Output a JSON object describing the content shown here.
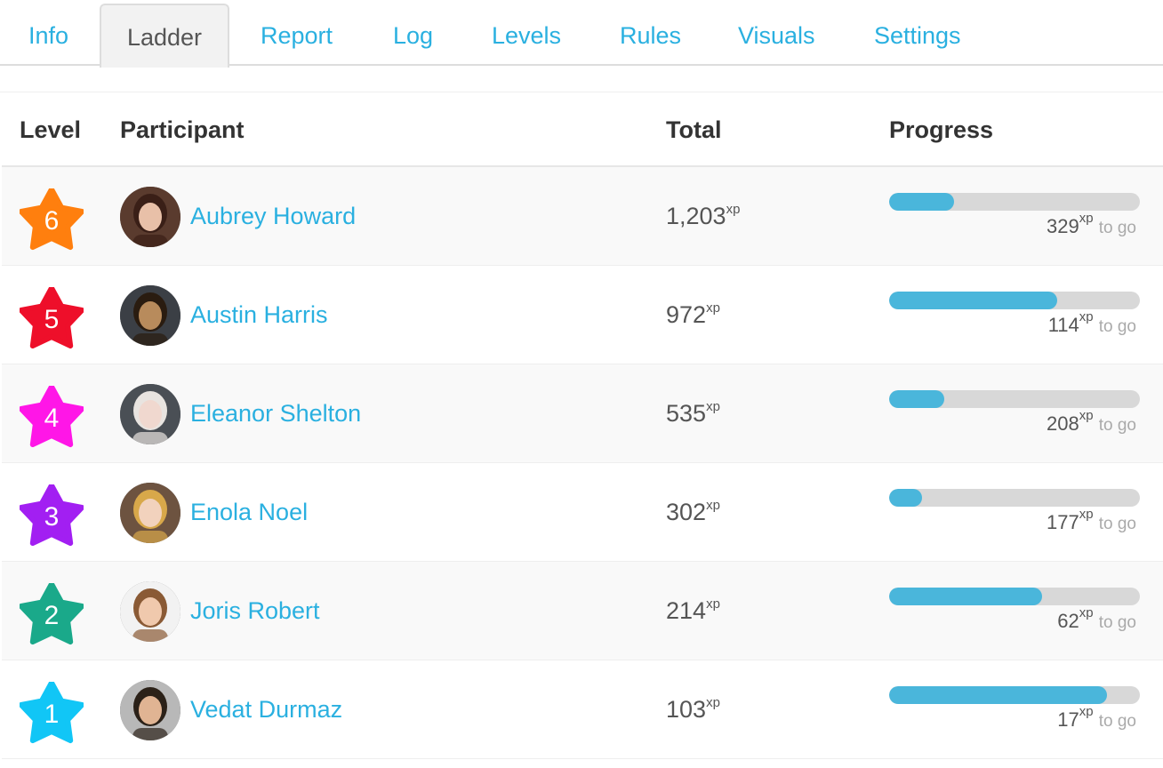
{
  "tabs": [
    {
      "label": "Info",
      "active": false
    },
    {
      "label": "Ladder",
      "active": true
    },
    {
      "label": "Report",
      "active": false
    },
    {
      "label": "Log",
      "active": false
    },
    {
      "label": "Levels",
      "active": false
    },
    {
      "label": "Rules",
      "active": false
    },
    {
      "label": "Visuals",
      "active": false
    },
    {
      "label": "Settings",
      "active": false
    }
  ],
  "table": {
    "headers": {
      "level": "Level",
      "participant": "Participant",
      "total": "Total",
      "progress": "Progress"
    },
    "unit": "xp",
    "togo_label": "to go",
    "rows": [
      {
        "level": "6",
        "star_color": "#ff7f0e",
        "name": "Aubrey Howard",
        "total": "1,203",
        "progress": 0.26,
        "togo": "329"
      },
      {
        "level": "5",
        "star_color": "#ee0f2a",
        "name": "Austin Harris",
        "total": "972",
        "progress": 0.67,
        "togo": "114"
      },
      {
        "level": "4",
        "star_color": "#ff16e7",
        "name": "Eleanor Shelton",
        "total": "535",
        "progress": 0.22,
        "togo": "208"
      },
      {
        "level": "3",
        "star_color": "#a21ff2",
        "name": "Enola Noel",
        "total": "302",
        "progress": 0.13,
        "togo": "177"
      },
      {
        "level": "2",
        "star_color": "#1aa98a",
        "name": "Joris Robert",
        "total": "214",
        "progress": 0.61,
        "togo": "62"
      },
      {
        "level": "1",
        "star_color": "#11c6f6",
        "name": "Vedat Durmaz",
        "total": "103",
        "progress": 0.87,
        "togo": "17"
      }
    ]
  },
  "colors": {
    "link": "#2ab0e0",
    "bar_fill": "#4ab6db",
    "bar_track": "#d8d8d8"
  }
}
